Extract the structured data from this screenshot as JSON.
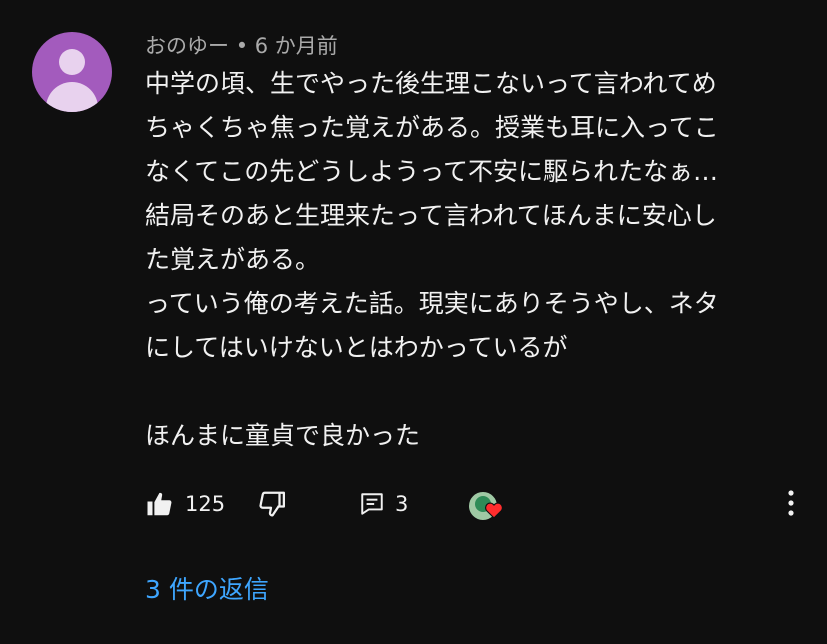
{
  "comment": {
    "author": "おのゆー",
    "separator": "•",
    "time": "6 か月前",
    "lines": [
      "中学の頃、生でやった後生理こないって言われてめ",
      "ちゃくちゃ焦った覚えがある。授業も耳に入ってこ",
      "なくてこの先どうしようって不安に駆られたなぁ…",
      "結局そのあと生理来たって言われてほんまに安心し",
      "た覚えがある。",
      "っていう俺の考えた話。現実にありそうやし、ネタ",
      "にしてはいけないとはわかっているが",
      "",
      "ほんまに童貞で良かった"
    ],
    "likes": "125",
    "reply_count": "3",
    "replies_label": "3 件の返信"
  },
  "icons": {
    "like": "thumbs-up-icon",
    "dislike": "thumbs-down-icon",
    "reply": "reply-comment-icon",
    "heart": "creator-heart-icon",
    "more": "more-vertical-icon"
  },
  "colors": {
    "background": "#0f0f0f",
    "text": "#f1f1f1",
    "secondary": "#aaaaaa",
    "link": "#3ea6ff",
    "avatar": "#a35bbd",
    "heart": "#ff2d2d"
  }
}
